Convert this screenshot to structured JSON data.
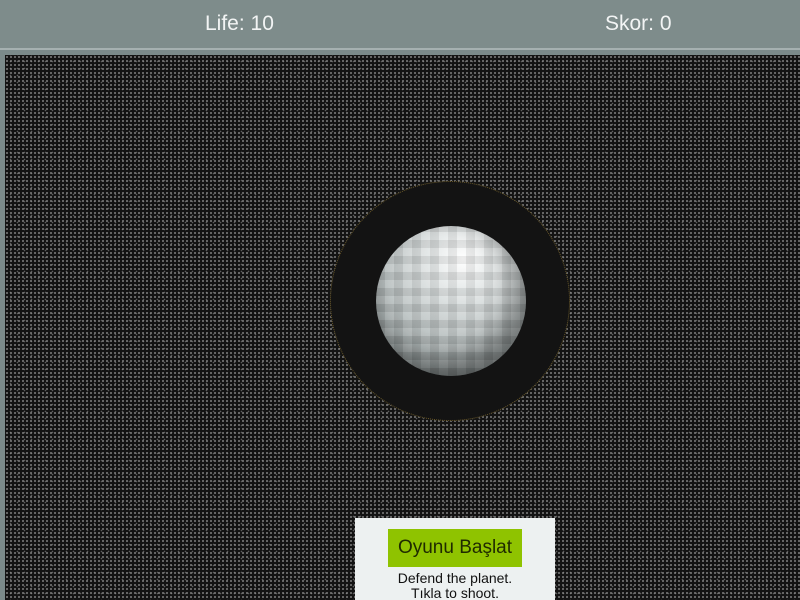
{
  "hud": {
    "life_text": "Life: 10",
    "score_text": "Skor: 0"
  },
  "menu": {
    "start_label": "Oyunu Başlat",
    "instructions_line1": "Defend the planet.",
    "instructions_line2": "Tıkla to shoot."
  },
  "colors": {
    "hud_bg": "#7e8c8b",
    "space_bg": "#131313",
    "start_button_bg": "#8fc300",
    "panel_bg": "#edf1f1"
  }
}
